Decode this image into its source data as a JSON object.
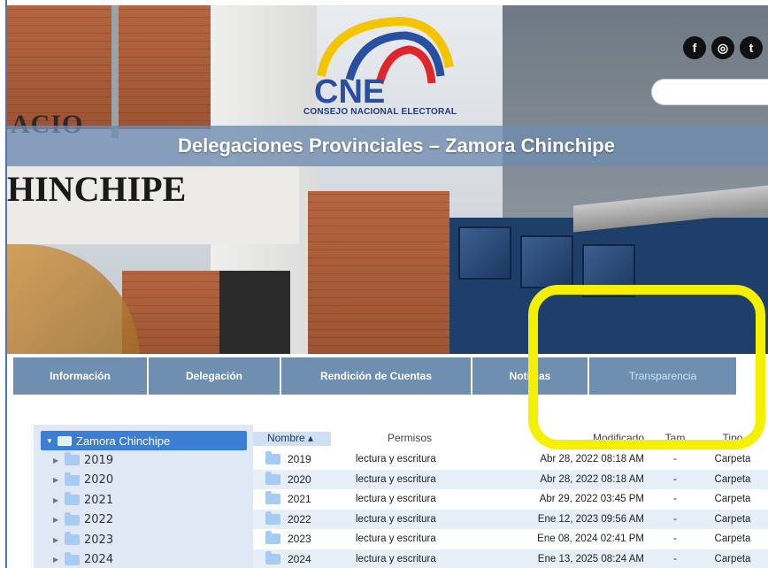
{
  "header": {
    "logo_word": "CNE",
    "logo_caption": "CONSEJO NACIONAL ELECTORAL",
    "page_title": "Delegaciones Provinciales – Zamora Chinchipe",
    "sign_top": "ACIO",
    "sign_bottom": "HINCHIPE",
    "social": [
      {
        "icon": "facebook-icon",
        "glyph": "f"
      },
      {
        "icon": "instagram-icon",
        "glyph": "◎"
      },
      {
        "icon": "twitter-icon",
        "glyph": "t"
      }
    ]
  },
  "nav": {
    "items": [
      {
        "label": "Información"
      },
      {
        "label": "Delegación"
      },
      {
        "label": "Rendición de Cuentas"
      },
      {
        "label": "Noticias"
      },
      {
        "label": "Transparencia"
      }
    ]
  },
  "file_manager": {
    "tree": {
      "root": "Zamora Chinchipe",
      "items": [
        "2019",
        "2020",
        "2021",
        "2022",
        "2023",
        "2024"
      ]
    },
    "columns": {
      "name": "Nombre",
      "permissions": "Permisos",
      "modified": "Modificado",
      "size": "Tam",
      "type": "Tipo"
    },
    "rows": [
      {
        "name": "2019",
        "perm": "lectura y escritura",
        "modified": "Abr 28, 2022 08:18 AM",
        "size": "-",
        "type": "Carpeta"
      },
      {
        "name": "2020",
        "perm": "lectura y escritura",
        "modified": "Abr 28, 2022 08:18 AM",
        "size": "-",
        "type": "Carpeta"
      },
      {
        "name": "2021",
        "perm": "lectura y escritura",
        "modified": "Abr 29, 2022 03:45 PM",
        "size": "-",
        "type": "Carpeta"
      },
      {
        "name": "2022",
        "perm": "lectura y escritura",
        "modified": "Ene 12, 2023 09:56 AM",
        "size": "-",
        "type": "Carpeta"
      },
      {
        "name": "2023",
        "perm": "lectura y escritura",
        "modified": "Ene 08, 2024 02:41 PM",
        "size": "-",
        "type": "Carpeta"
      },
      {
        "name": "2024",
        "perm": "lectura y escritura",
        "modified": "Ene 13, 2025 08:24 AM",
        "size": "-",
        "type": "Carpeta"
      }
    ]
  },
  "colors": {
    "nav_bg": "#6f8fb0",
    "tree_selected": "#3a7fd5",
    "highlight": "#f5f000",
    "logo_blue": "#1f3c7a"
  }
}
